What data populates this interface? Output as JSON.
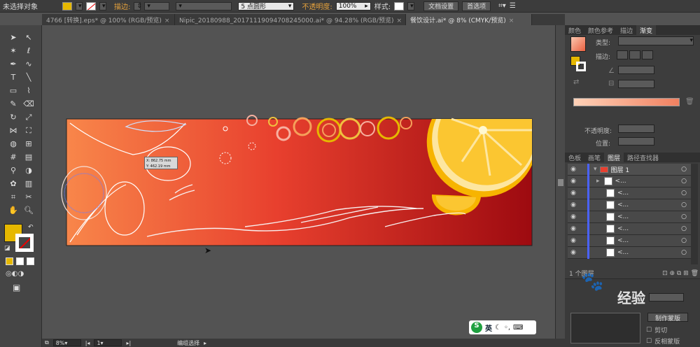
{
  "control_bar": {
    "no_selection": "未选择对象",
    "stroke_label": "描边:",
    "brush": "5 点圆形",
    "opacity_label": "不透明度:",
    "opacity_value": "100%",
    "style_label": "样式:",
    "doc_setup": "文档设置",
    "preferences": "首选项",
    "fill_color": "#e6b800"
  },
  "tabs": [
    {
      "label": "4766 [转换].eps* @ 100% (RGB/预览)"
    },
    {
      "label": "Nipic_20180988_20171119094708245000.ai* @ 94.28% (RGB/预览)"
    },
    {
      "label": "餐饮设计.ai* @ 8% (CMYK/预览)"
    }
  ],
  "tooltip": {
    "x": "X: 862.75 mm",
    "y": "Y: 462.19 mm"
  },
  "right_panel": {
    "top_tabs": [
      "颜色",
      "颜色参考",
      "描边",
      "渐变"
    ],
    "type_label": "类型:",
    "stroke_label": "描边:",
    "opacity_label": "不透明度:",
    "position_label": "位置:",
    "layer_tabs": [
      "色板",
      "画笔",
      "图层",
      "路径查找器"
    ],
    "layer_name": "图层 1",
    "sublayers": [
      "<...",
      "<...",
      "<...",
      "<...",
      "<...",
      "<...",
      "<..."
    ],
    "layer_count": "1 个图层",
    "mask_btn": "制作蒙版",
    "clip_label": "剪切",
    "invert_label": "反相蒙版",
    "gradient_from": "#ffd2b8",
    "gradient_to": "#f08060"
  },
  "status": {
    "zoom": "8%",
    "page": "1",
    "mode": "编组选择"
  },
  "watermark": {
    "brand": "经验",
    "ime": "英"
  }
}
